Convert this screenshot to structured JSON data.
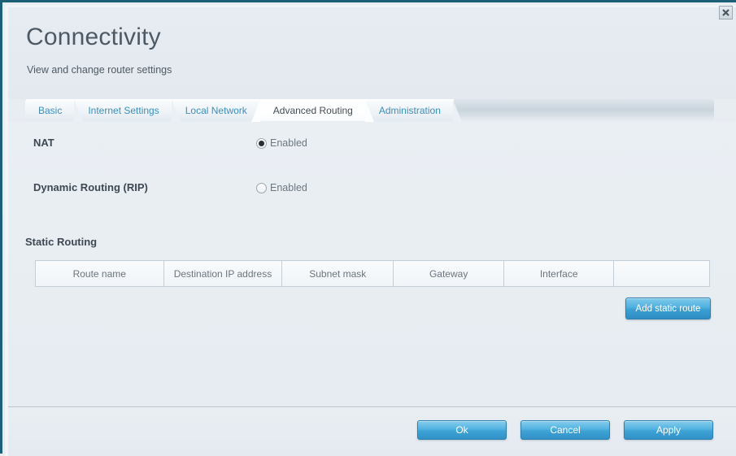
{
  "window": {
    "close_icon": "close-icon",
    "accent_color": "#3ba0d4",
    "frame_color": "#1d5f77"
  },
  "header": {
    "title": "Connectivity",
    "subtitle": "View and change router settings"
  },
  "tabs": [
    {
      "label": "Basic",
      "active": false
    },
    {
      "label": "Internet Settings",
      "active": false
    },
    {
      "label": "Local Network",
      "active": false
    },
    {
      "label": "Advanced Routing",
      "active": true
    },
    {
      "label": "Administration",
      "active": false
    }
  ],
  "settings": [
    {
      "label": "NAT",
      "option_label": "Enabled",
      "checked": true
    },
    {
      "label": "Dynamic Routing (RIP)",
      "option_label": "Enabled",
      "checked": false
    }
  ],
  "static_routing": {
    "heading": "Static Routing",
    "columns": [
      "Route name",
      "Destination IP address",
      "Subnet mask",
      "Gateway",
      "Interface",
      ""
    ],
    "rows": [],
    "add_button_label": "Add static route"
  },
  "footer": {
    "ok_label": "Ok",
    "cancel_label": "Cancel",
    "apply_label": "Apply"
  }
}
